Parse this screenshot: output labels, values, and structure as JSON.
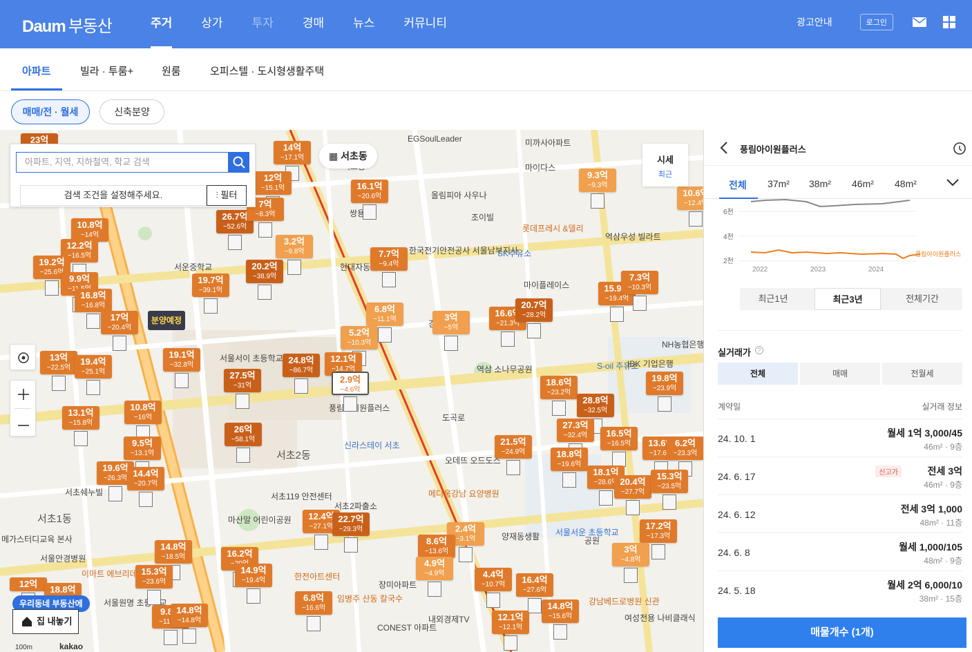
{
  "header": {
    "logo_brand": "Daum",
    "logo_service": "부동산",
    "nav": [
      "주거",
      "상가",
      "투자",
      "경매",
      "뉴스",
      "커뮤니티"
    ],
    "active_nav": "주거",
    "ad_link": "광고안내",
    "login": "로그인"
  },
  "subnav": {
    "tabs": [
      "아파트",
      "빌라 · 투룸+",
      "원룸",
      "오피스텔 · 도시형생활주택"
    ],
    "active": "아파트"
  },
  "filters": {
    "trade": "매매/전 · 월세",
    "presale": "신축분양"
  },
  "map": {
    "search_placeholder": "아파트, 지역, 지하철역, 학교 검색",
    "condition_text": "검색 조건을 설정해주세요.",
    "filter_label": "필터",
    "area_name": "서초동",
    "price_chip_title": "시세",
    "price_chip_sub": "최근",
    "presale_badge": "분양예정",
    "banner": "우리동네 부동산에",
    "sell_button": "집 내놓기",
    "scale": "100m",
    "brand": "kakao",
    "labels": [
      "서초1동",
      "서초2동",
      "조이빌",
      "서초동",
      "한국전기안전공사 서울남부지사",
      "롯데프레시 &델리",
      "SK주유소",
      "마이플레이스",
      "도곡로",
      "서운중학교",
      "서초119 안전센터",
      "서초2파출소",
      "마산말 어린이공원",
      "한전아트센터",
      "장미아파트",
      "양재동생활",
      "강남베드로병원 신관",
      "여성전용 나비클래식",
      "S-oil 주유소",
      "NH농협은행",
      "서울서이 초등학교",
      "풍림아이원플러스",
      "메디움강남 요양병원",
      "서울서운 초등학교",
      "서울원명 초등학교",
      "IBK 기업은행",
      "역삼 소나무공원",
      "서초쉐누빌",
      "서울안경병원",
      "메가스터디교육 본사",
      "이마트 에브리데이",
      "임병주 산동 칼국수",
      "내외경제TV",
      "CONEST 아파트",
      "신라스테이 서초",
      "현대자동차",
      "올림피아 사우나",
      "EGSoulLeader",
      "마이다스",
      "쌍용",
      "미까사아파트",
      "역삼우성 빌라트",
      "오데뜨 오드도스",
      "공원",
      "강남 아파트"
    ],
    "markers": [
      {
        "p": "23억",
        "s": ""
      },
      {
        "p": "14억",
        "s": "~17.1억"
      },
      {
        "p": "12억",
        "s": "~15.1억"
      },
      {
        "p": "16.1억",
        "s": "~20.6억"
      },
      {
        "p": "26.7억",
        "s": "~52.6억"
      },
      {
        "p": "7억",
        "s": "~8.3억"
      },
      {
        "p": "3.2억",
        "s": "~9.8억"
      },
      {
        "p": "10.8억",
        "s": "~14억"
      },
      {
        "p": "12.2억",
        "s": "~16.5억"
      },
      {
        "p": "19.2억",
        "s": "~25.6억"
      },
      {
        "p": "9.9억",
        "s": "~11.5억"
      },
      {
        "p": "16.8억",
        "s": "~16.8억"
      },
      {
        "p": "17억",
        "s": "~20.4억"
      },
      {
        "p": "19.7억",
        "s": "~39.1억"
      },
      {
        "p": "20.2억",
        "s": "~38.9억"
      },
      {
        "p": "7.7억",
        "s": "~9.4억"
      },
      {
        "p": "6.8억",
        "s": "~11.1억"
      },
      {
        "p": "5.2억",
        "s": "~10.3억"
      },
      {
        "p": "3억",
        "s": "~5억"
      },
      {
        "p": "16.6억",
        "s": "~21.3억"
      },
      {
        "p": "20.7억",
        "s": "~28.2억"
      },
      {
        "p": "9.3억",
        "s": "~9.3억"
      },
      {
        "p": "15.9억",
        "s": "~19.4억"
      },
      {
        "p": "7.3억",
        "s": "~10.3억"
      },
      {
        "p": "10.6억",
        "s": "~12.4억"
      },
      {
        "p": "13억",
        "s": "~22.5억"
      },
      {
        "p": "19.4억",
        "s": "~25.1억"
      },
      {
        "p": "19.1억",
        "s": "~32.8억"
      },
      {
        "p": "27.5억",
        "s": "~31억"
      },
      {
        "p": "24.8억",
        "s": "~86.7억"
      },
      {
        "p": "12.1억",
        "s": "~14.7억"
      },
      {
        "p": "2.9억",
        "s": "~4.6억"
      },
      {
        "p": "10.8억",
        "s": "~16억"
      },
      {
        "p": "13.1억",
        "s": "~15.8억"
      },
      {
        "p": "9.5억",
        "s": "~13.1억"
      },
      {
        "p": "26억",
        "s": "~58.1억"
      },
      {
        "p": "19.6억",
        "s": "~26.3억"
      },
      {
        "p": "14.4억",
        "s": "~20.7억"
      },
      {
        "p": "18.6억",
        "s": "~23.2억"
      },
      {
        "p": "28.8억",
        "s": "~32.5억"
      },
      {
        "p": "27.3억",
        "s": "~32.4억"
      },
      {
        "p": "21.5억",
        "s": "~24.9억"
      },
      {
        "p": "18.8억",
        "s": "~19.6억"
      },
      {
        "p": "16.5억",
        "s": "~16.5억"
      },
      {
        "p": "13.6억",
        "s": "~17.6억"
      },
      {
        "p": "6.2억",
        "s": "~23.3억"
      },
      {
        "p": "19.8억",
        "s": "~23.9억"
      },
      {
        "p": "18.1억",
        "s": "~28.6억"
      },
      {
        "p": "20.4억",
        "s": "~27.7억"
      },
      {
        "p": "15.3억",
        "s": "~23.5억"
      },
      {
        "p": "17.2억",
        "s": "~17.3억"
      },
      {
        "p": "12.4억",
        "s": "~27.1억"
      },
      {
        "p": "22.7억",
        "s": "~29.3억"
      },
      {
        "p": "2.4억",
        "s": "~3.1억"
      },
      {
        "p": "14.8억",
        "s": "~18.5억"
      },
      {
        "p": "16.2억",
        "s": "~20억"
      },
      {
        "p": "14.9억",
        "s": "~19.4억"
      },
      {
        "p": "15.3억",
        "s": "~23.6억"
      },
      {
        "p": "8.6억",
        "s": "~13.6억"
      },
      {
        "p": "4.9억",
        "s": "~4.9억"
      },
      {
        "p": "4.4억",
        "s": "~10.7억"
      },
      {
        "p": "16.4억",
        "s": "~27.6억"
      },
      {
        "p": "3억",
        "s": "~4.8억"
      },
      {
        "p": "12억",
        "s": ""
      },
      {
        "p": "18.8억",
        "s": ""
      },
      {
        "p": "9.8억",
        "s": "~11.2억"
      },
      {
        "p": "14.8억",
        "s": "~14.8억"
      },
      {
        "p": "6.8억",
        "s": "~16.6억"
      },
      {
        "p": "12.1억",
        "s": "~12.1억"
      },
      {
        "p": "14.8억",
        "s": "~15.6억"
      }
    ]
  },
  "panel": {
    "title": "풍림아이원플러스",
    "area_tabs": [
      "전체",
      "37m²",
      "38m²",
      "46m²",
      "48m²"
    ],
    "chart": {
      "type": "line",
      "y_ticks": [
        "6천",
        "4천",
        "2천"
      ],
      "x_ticks": [
        "2022",
        "2023",
        "2024"
      ],
      "series_label": "풍림아이원플러스"
    },
    "periods": [
      "최근1년",
      "최근3년",
      "전체기간"
    ],
    "active_period": "최근3년",
    "section_title": "실거래가",
    "types": [
      "전체",
      "매매",
      "전월세"
    ],
    "col_date": "계약일",
    "col_info": "실거래 정보",
    "rows": [
      {
        "date": "24. 10. 1",
        "price": "월세 1억 3,000/45",
        "detail": "46m² · 9층",
        "tag": ""
      },
      {
        "date": "24. 6. 17",
        "price": "전세 3억",
        "detail": "46m² · 9층",
        "tag": "신고가"
      },
      {
        "date": "24. 6. 12",
        "price": "전세 3억 1,000",
        "detail": "48m² · 11층",
        "tag": ""
      },
      {
        "date": "24. 6. 8",
        "price": "월세 1,000/105",
        "detail": "48m² · 9층",
        "tag": ""
      },
      {
        "date": "24. 5. 18",
        "price": "월세 2억 6,000/10",
        "detail": "38m² · 15층",
        "tag": ""
      }
    ],
    "listing_button": "매물개수 (1개)"
  },
  "colors": {
    "header_blue": "#4a82e6",
    "accent_blue": "#2f6fe0",
    "marker_orange": "#e07a2b",
    "chart_orange": "#f07d16",
    "chart_gray": "#888888"
  }
}
